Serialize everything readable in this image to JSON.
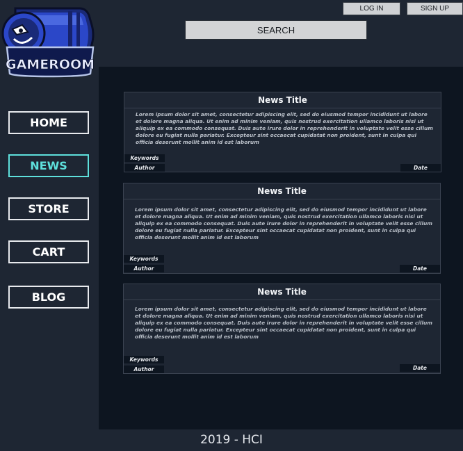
{
  "header": {
    "login_label": "LOG IN",
    "signup_label": "SIGN UP",
    "search_label": "SEARCH"
  },
  "logo": {
    "text": "GAMEROOM"
  },
  "nav": {
    "items": [
      {
        "label": "HOME"
      },
      {
        "label": "NEWS"
      },
      {
        "label": "STORE"
      },
      {
        "label": "CART"
      },
      {
        "label": "BLOG"
      }
    ],
    "active_color": "#5ee0dc"
  },
  "news": [
    {
      "title": "News Title",
      "body": "Lorem ipsum dolor sit amet, consectetur adipiscing elit, sed do eiusmod tempor incididunt ut labore et dolore magna aliqua. Ut enim ad minim veniam, quis nostrud exercitation ullamco laboris nisi ut aliquip ex ea commodo consequat. Duis aute irure dolor in reprehenderit in voluptate velit esse cillum dolore eu fugiat nulla pariatur. Excepteur sint occaecat cupidatat non proident, sunt in culpa qui officia deserunt mollit anim id est laborum",
      "keywords": "Keywords",
      "author": "Author",
      "date": "Date"
    },
    {
      "title": "News Title",
      "body": "Lorem ipsum dolor sit amet, consectetur adipiscing elit, sed do eiusmod tempor incididunt ut labore et dolore magna aliqua. Ut enim ad minim veniam, quis nostrud exercitation ullamco laboris nisi ut aliquip ex ea commodo consequat. Duis aute irure dolor in reprehenderit in voluptate velit esse cillum dolore eu fugiat nulla pariatur. Excepteur sint occaecat cupidatat non proident, sunt in culpa qui officia deserunt mollit anim id est laborum",
      "keywords": "Keywords",
      "author": "Author",
      "date": "Date"
    },
    {
      "title": "News Title",
      "body": "Lorem ipsum dolor sit amet, consectetur adipiscing elit, sed do eiusmod tempor incididunt ut labore et dolore magna aliqua. Ut enim ad minim veniam, quis nostrud exercitation ullamco laboris nisi ut aliquip ex ea commodo consequat. Duis aute irure dolor in reprehenderit in voluptate velit esse cillum dolore eu fugiat nulla pariatur. Excepteur sint occaecat cupidatat non proident, sunt in culpa qui officia deserunt mollit anim id est laborum",
      "keywords": "Keywords",
      "author": "Author",
      "date": "Date"
    }
  ],
  "footer": {
    "text": "2019 - HCI"
  }
}
